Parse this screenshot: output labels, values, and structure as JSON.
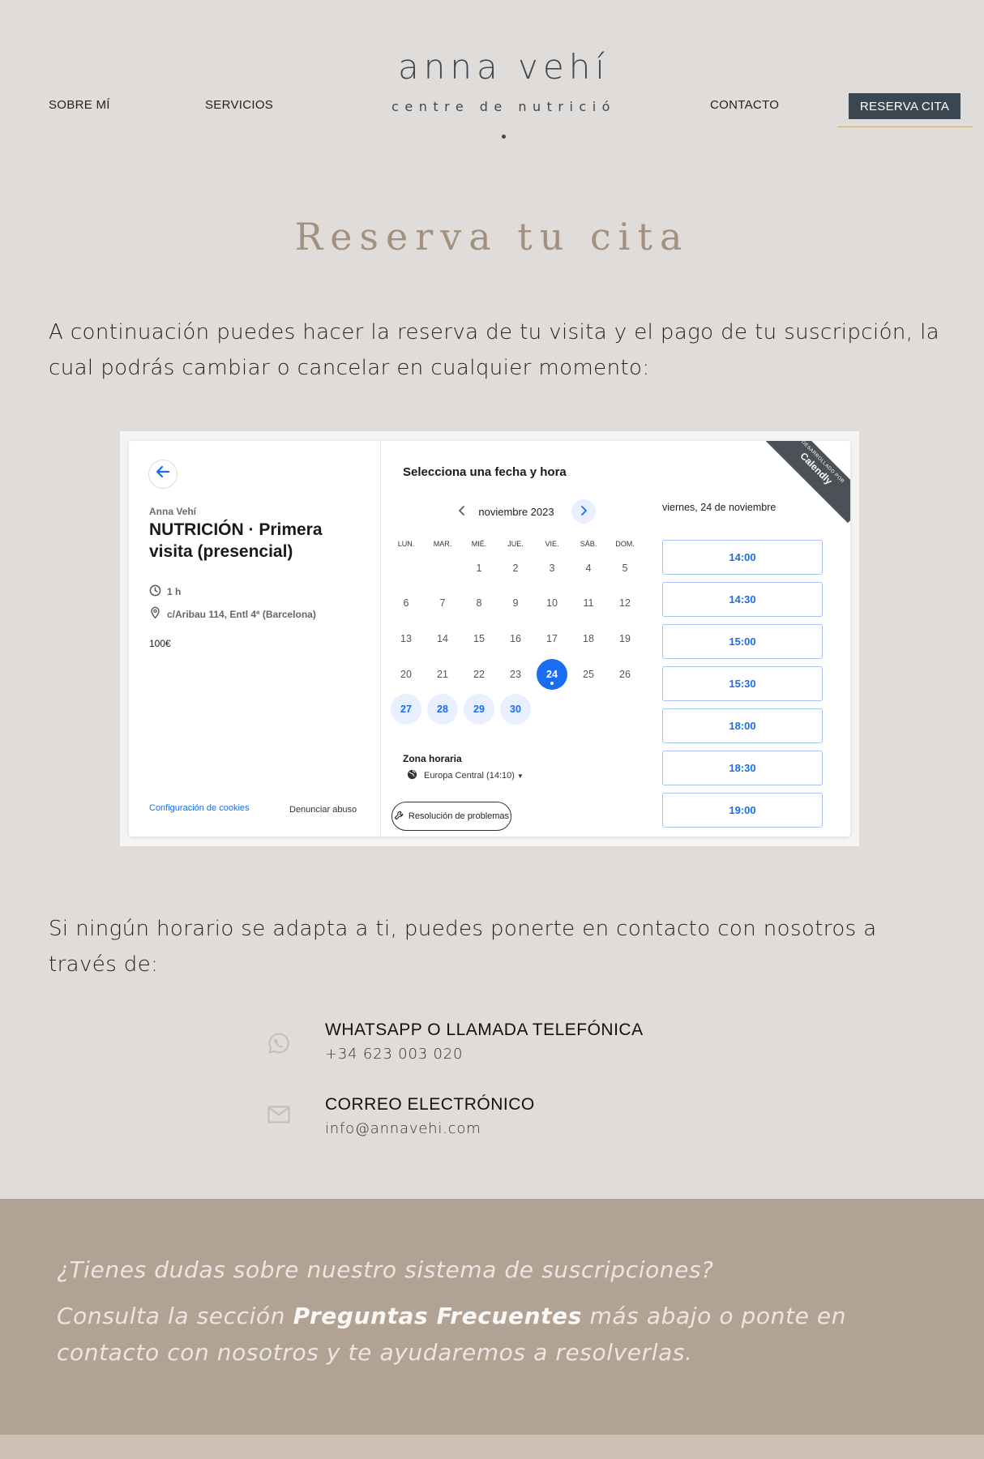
{
  "header": {
    "nav_left": [
      "SOBRE MÍ",
      "SERVICIOS"
    ],
    "nav_right": [
      "CONTACTO"
    ],
    "logo_title": "anna vehí",
    "logo_subtitle": "centre de nutrició",
    "cta_label": "RESERVA CITA"
  },
  "main": {
    "title": "Reserva tu cita",
    "intro": "A continuación puedes hacer la reserva de tu visita y el pago de tu suscripción, la cual podrás cambiar o cancelar en cualquier momento:",
    "fallback": "Si ningún horario se adapta a ti, puedes ponerte en contacto con nosotros a través de:"
  },
  "calendly": {
    "host": "Anna Vehí",
    "event_name": "NUTRICIÓN · Primera visita (presencial)",
    "duration": "1 h",
    "location": "c/Aribau 114, Entl 4ª (Barcelona)",
    "price": "100€",
    "cookies_link": "Configuración de cookies",
    "report_link": "Denunciar abuso",
    "picker_title": "Selecciona una fecha y hora",
    "month": "noviembre 2023",
    "weekdays": [
      "LUN.",
      "MAR.",
      "MIÉ.",
      "JUE.",
      "VIE.",
      "SÁB.",
      "DOM."
    ],
    "days": [
      "1",
      "2",
      "3",
      "4",
      "5",
      "6",
      "7",
      "8",
      "9",
      "10",
      "11",
      "12",
      "13",
      "14",
      "15",
      "16",
      "17",
      "18",
      "19",
      "20",
      "21",
      "22",
      "23",
      "24",
      "25",
      "26",
      "27",
      "28",
      "29",
      "30"
    ],
    "available_days": [
      "27",
      "28",
      "29",
      "30"
    ],
    "selected_day": "24",
    "timezone_title": "Zona horaria",
    "timezone_value": "Europa Central (14:10)",
    "troubleshoot": "Resolución de problemas",
    "selected_date_label": "viernes, 24 de noviembre",
    "slots": [
      "14:00",
      "14:30",
      "15:00",
      "15:30",
      "18:00",
      "18:30",
      "19:00"
    ],
    "ribbon_small": "DESARROLLADO POR",
    "ribbon_brand": "Calendly",
    "accent_color": "#1a6cf0"
  },
  "contact": {
    "items": [
      {
        "icon": "whatsapp-icon",
        "title": "WHATSAPP O LLAMADA TELEFÓNICA",
        "value": "+34 623 003 020"
      },
      {
        "icon": "mail-icon",
        "title": "CORREO ELECTRÓNICO",
        "value": "info@annavehi.com"
      }
    ]
  },
  "faq": {
    "question": "¿Tienes dudas sobre nuestro sistema de suscripciones?",
    "text_before": "Consulta la sección ",
    "bold": "Preguntas Frecuentes",
    "text_after": " más abajo o ponte en contacto con nosotros y te ayudaremos a resolverlas."
  },
  "colors": {
    "background": "#e0dcd9",
    "title": "#a39180",
    "logo": "#3f4850",
    "button": "#3a4750",
    "gold_line": "#c9ad74",
    "faq_bg": "#b2a294"
  }
}
